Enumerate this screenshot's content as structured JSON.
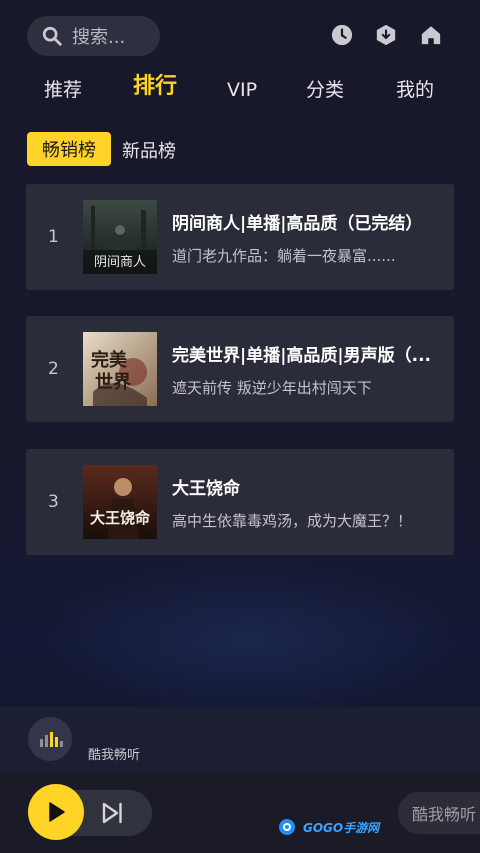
{
  "search": {
    "placeholder": "搜索..."
  },
  "header_icons": [
    "history-icon",
    "download-icon",
    "home-icon"
  ],
  "tabs": [
    {
      "label": "推荐",
      "active": false
    },
    {
      "label": "排行",
      "active": true
    },
    {
      "label": "VIP",
      "active": false
    },
    {
      "label": "分类",
      "active": false
    },
    {
      "label": "我的",
      "active": false
    }
  ],
  "subtabs": [
    {
      "label": "畅销榜",
      "active": true
    },
    {
      "label": "新品榜",
      "active": false
    }
  ],
  "books": [
    {
      "rank": "1",
      "title": "阴间商人|单播|高品质（已完结）",
      "desc": "道门老九作品：躺着一夜暴富......",
      "cover_text": "阴间商人"
    },
    {
      "rank": "2",
      "title": "完美世界|单播|高品质|男声版（...",
      "desc": "遮天前传 叛逆少年出村闯天下",
      "cover_text": "完美世界"
    },
    {
      "rank": "3",
      "title": "大王饶命",
      "desc": "高中生依靠毒鸡汤，成为大魔王？！",
      "cover_text": "大王饶命"
    }
  ],
  "mini_player": {
    "label": "酷我畅听"
  },
  "player": {
    "brand": "酷我畅听"
  },
  "watermark": {
    "text": "GOGO手游网"
  },
  "colors": {
    "accent": "#ffd426",
    "background": "#17182a",
    "card": "#2a2c3a"
  }
}
